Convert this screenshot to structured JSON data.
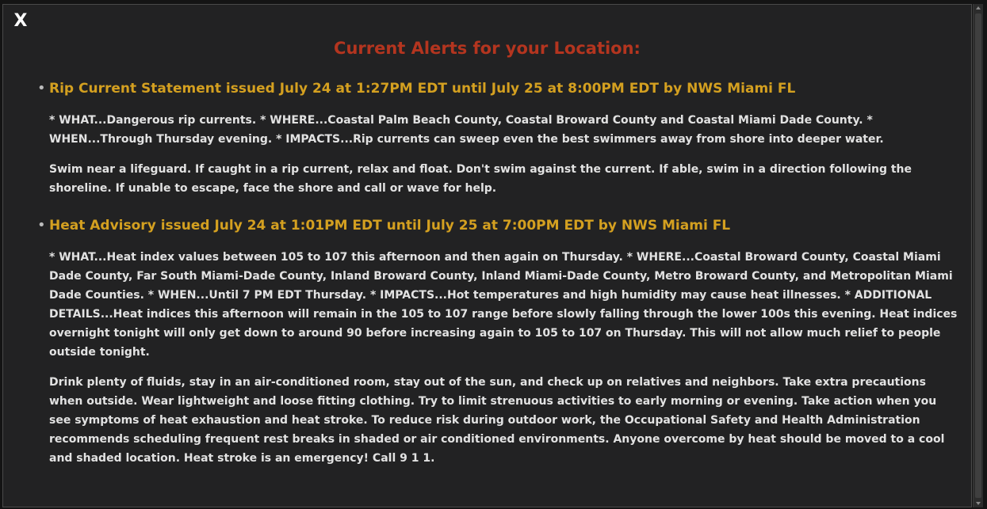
{
  "modal": {
    "close_label": "X",
    "title": "Current Alerts for your Location:",
    "accent_title_color": "#b4351f",
    "heading_color": "#d4a020"
  },
  "alerts": [
    {
      "heading": "Rip Current Statement issued July 24 at 1:27PM EDT until July 25 at 8:00PM EDT by NWS Miami FL",
      "description": "* WHAT...Dangerous rip currents. * WHERE...Coastal Palm Beach County, Coastal Broward County and Coastal Miami Dade County. * WHEN...Through Thursday evening. * IMPACTS...Rip currents can sweep even the best swimmers away from shore into deeper water.",
      "instruction": "Swim near a lifeguard. If caught in a rip current, relax and float. Don't swim against the current. If able, swim in a direction following the shoreline. If unable to escape, face the shore and call or wave for help."
    },
    {
      "heading": "Heat Advisory issued July 24 at 1:01PM EDT until July 25 at 7:00PM EDT by NWS Miami FL",
      "description": "* WHAT...Heat index values between 105 to 107 this afternoon and then again on Thursday. * WHERE...Coastal Broward County, Coastal Miami Dade County, Far South Miami-Dade County, Inland Broward County, Inland Miami-Dade County, Metro Broward County, and Metropolitan Miami Dade Counties. * WHEN...Until 7 PM EDT Thursday. * IMPACTS...Hot temperatures and high humidity may cause heat illnesses. * ADDITIONAL DETAILS...Heat indices this afternoon will remain in the 105 to 107 range before slowly falling through the lower 100s this evening. Heat indices overnight tonight will only get down to around 90 before increasing again to 105 to 107 on Thursday. This will not allow much relief to people outside tonight.",
      "instruction": "Drink plenty of fluids, stay in an air-conditioned room, stay out of the sun, and check up on relatives and neighbors. Take extra precautions when outside. Wear lightweight and loose fitting clothing. Try to limit strenuous activities to early morning or evening. Take action when you see symptoms of heat exhaustion and heat stroke. To reduce risk during outdoor work, the Occupational Safety and Health Administration recommends scheduling frequent rest breaks in shaded or air conditioned environments. Anyone overcome by heat should be moved to a cool and shaded location. Heat stroke is an emergency! Call 9 1 1."
    }
  ]
}
